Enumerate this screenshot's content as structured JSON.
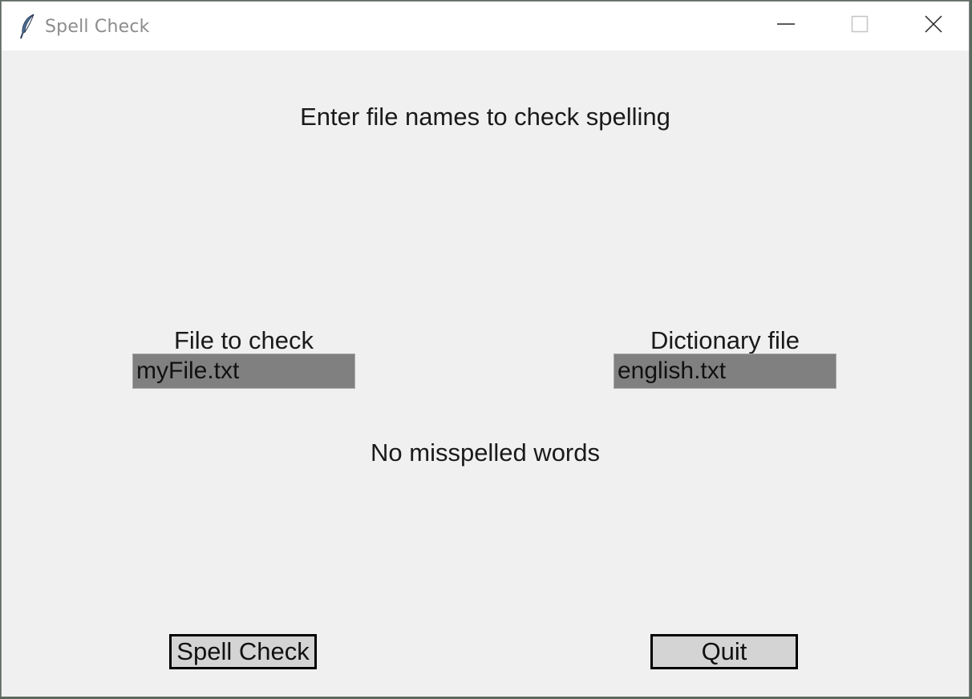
{
  "window": {
    "title": "Spell Check",
    "icon": "feather-icon",
    "controls": [
      "minimize-icon",
      "maximize-icon",
      "close-icon"
    ]
  },
  "main": {
    "heading": "Enter file names to check spelling",
    "file_label": "File to check",
    "file_value": "myFile.txt",
    "dictionary_label": "Dictionary file",
    "dictionary_value": "english.txt",
    "status": "No misspelled words"
  },
  "buttons": {
    "spell_check_label": "Spell Check",
    "quit_label": "Quit"
  },
  "colors": {
    "window_bg": "#f0f0f0",
    "titlebar_bg": "#ffffff",
    "entry_bg": "#808080",
    "button_bg": "#d4d4d4"
  }
}
